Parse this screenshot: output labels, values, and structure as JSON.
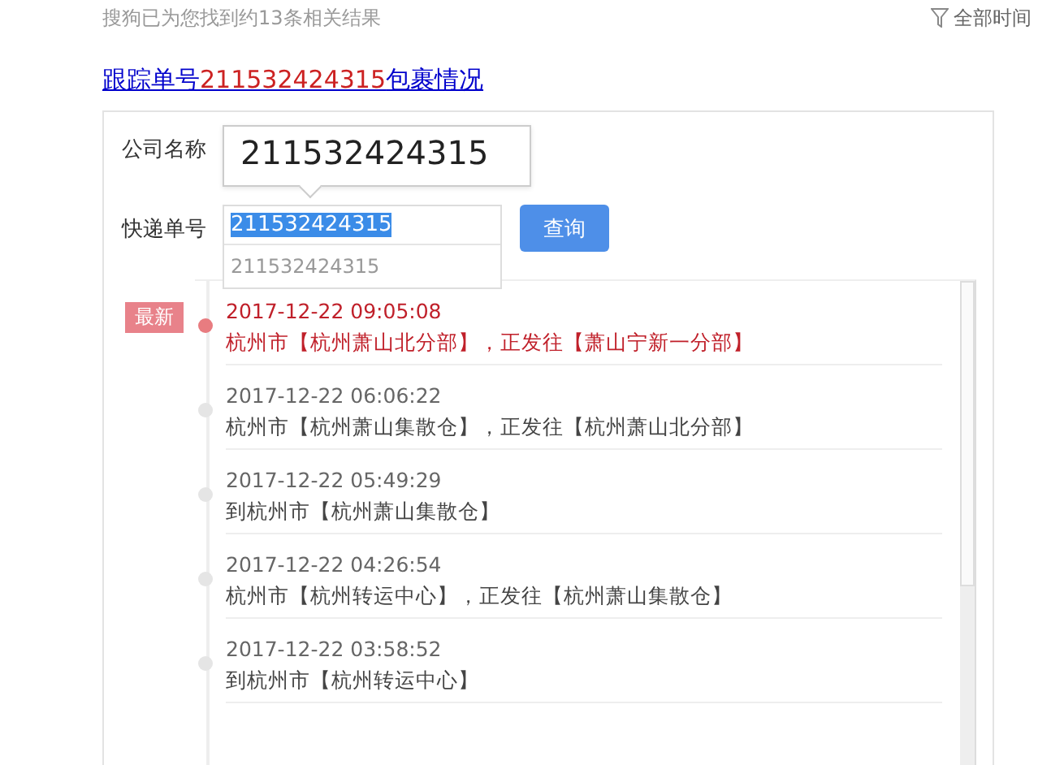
{
  "result_count": "搜狗已为您找到约13条相关结果",
  "time_filter": "全部时间",
  "title_link": {
    "before": "跟踪单号",
    "number": "211532424315",
    "after": "包裹情况"
  },
  "form": {
    "company_label": "公司名称",
    "company_value": "211532424315",
    "number_label": "快递单号",
    "number_value": "211532424315",
    "suggestion": "211532424315",
    "button": "查询"
  },
  "latest_badge": "最新",
  "events": [
    {
      "time": "2017-12-22 09:05:08",
      "text": "杭州市【杭州萧山北分部】，正发往【萧山宁新一分部】",
      "latest": true
    },
    {
      "time": "2017-12-22 06:06:22",
      "text": "杭州市【杭州萧山集散仓】，正发往【杭州萧山北分部】",
      "latest": false
    },
    {
      "time": "2017-12-22 05:49:29",
      "text": "到杭州市【杭州萧山集散仓】",
      "latest": false
    },
    {
      "time": "2017-12-22 04:26:54",
      "text": "杭州市【杭州转运中心】，正发往【杭州萧山集散仓】",
      "latest": false
    },
    {
      "time": "2017-12-22 03:58:52",
      "text": "到杭州市【杭州转运中心】",
      "latest": false
    }
  ]
}
